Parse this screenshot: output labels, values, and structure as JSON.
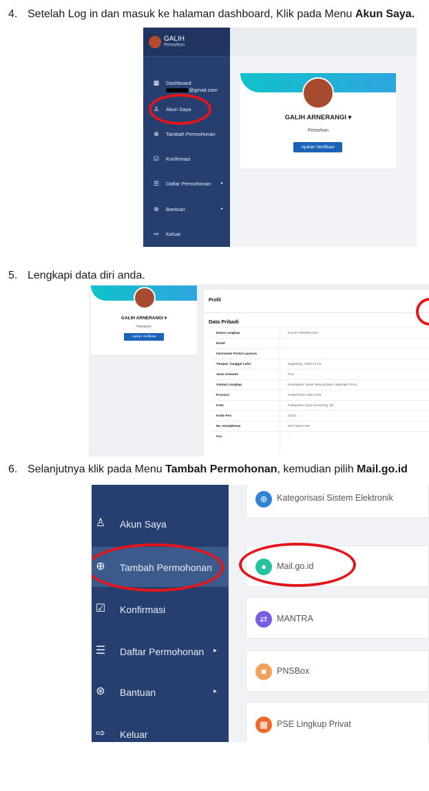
{
  "steps": [
    {
      "num": "4.",
      "pre": "Setelah Log in dan masuk ke halaman dashboard, Klik pada Menu ",
      "bold": "Akun Saya.",
      "mid": "",
      "bold2": ""
    },
    {
      "num": "5.",
      "pre": "Lengkapi data diri anda.",
      "bold": "",
      "mid": "",
      "bold2": ""
    },
    {
      "num": "6.",
      "pre": "Selanjutnya klik pada Menu ",
      "bold": "Tambah Permohonan",
      "mid": ", kemudian pilih ",
      "bold2": "Mail.go.id"
    }
  ],
  "shot1": {
    "user_name": "GALIH",
    "user_role": "Pemohon",
    "menu": [
      {
        "label": "Dashboard",
        "sub": "@gmail.com",
        "icon": "grid-icon"
      },
      {
        "label": "Akun Saya",
        "icon": "user-icon"
      },
      {
        "label": "Tambah Permohonan",
        "icon": "plus-circle-icon"
      },
      {
        "label": "Konfirmasi",
        "icon": "check-square-icon"
      },
      {
        "label": "Daftar Permohonan",
        "icon": "list-icon",
        "arrow": "▸"
      },
      {
        "label": "Bantuan",
        "icon": "lifebuoy-icon",
        "arrow": "▸"
      },
      {
        "label": "Keluar",
        "icon": "sign-out-icon"
      }
    ],
    "profile_name": "GALIH ARNERANGI ▾",
    "profile_role": "Pemohon",
    "verify_button": "Ajukan Verifikasi"
  },
  "shot2": {
    "profile_name": "GALIH ARNERANGI ▾",
    "profile_role": "Pemohon",
    "verify_button": "Ajukan Verifikasi",
    "panel_title": "Profil",
    "section_title": "Data Pribadi",
    "rows": [
      {
        "k": "Nama Lengkap",
        "v": "GALIH ARNERANGI"
      },
      {
        "k": "Email",
        "v": ""
      },
      {
        "k": "Username Portal Layanan",
        "v": ""
      },
      {
        "k": "Tempat, Tanggal Lahir",
        "v": "Magelang, 1990-12-04"
      },
      {
        "k": "Jenis Kelamin",
        "v": "Pria"
      },
      {
        "k": "Alamat Lengkap",
        "v": "Karangsari, Desa Tanjung Baru, Baturaja Timur"
      },
      {
        "k": "Provinsi",
        "v": "SUMATERA SELATAN"
      },
      {
        "k": "Kota",
        "v": "Kabupaten Ogan Komering Ulu"
      },
      {
        "k": "Kode Pos",
        "v": "32111"
      },
      {
        "k": "No. Handphone",
        "v": "087745617180"
      },
      {
        "k": "Fax",
        "v": "-"
      }
    ]
  },
  "shot3": {
    "menu": [
      {
        "label": "Akun Saya",
        "icon": "user-icon"
      },
      {
        "label": "Tambah Permohonan",
        "icon": "plus-circle-icon"
      },
      {
        "label": "Konfirmasi",
        "icon": "check-square-icon"
      },
      {
        "label": "Daftar Permohonan",
        "icon": "list-icon",
        "arrow": "▸"
      },
      {
        "label": "Bantuan",
        "icon": "lifebuoy-icon",
        "arrow": "▸"
      },
      {
        "label": "Keluar",
        "icon": "sign-out-icon"
      }
    ],
    "services": [
      {
        "label": "Kategorisasi Sistem Elektronik",
        "color": "#2f84d6",
        "icon": "globe-icon",
        "glyph": "⊕"
      },
      {
        "label": "Mail.go.id",
        "color": "#26c3a0",
        "icon": "mail-logo-icon",
        "glyph": "●"
      },
      {
        "label": "MANTRA",
        "color": "#7a5ce6",
        "icon": "swap-icon",
        "glyph": "⇄"
      },
      {
        "label": "PNSBox",
        "color": "#f2a15c",
        "icon": "lock-icon",
        "glyph": "■"
      },
      {
        "label": "PSE Lingkup Privat",
        "color": "#ef6a2a",
        "icon": "building-icon",
        "glyph": "▦"
      }
    ]
  },
  "colors": {
    "sidebar": "#263f70",
    "highlight_ring": "#e4141b",
    "primary_button": "#1a63b8"
  }
}
